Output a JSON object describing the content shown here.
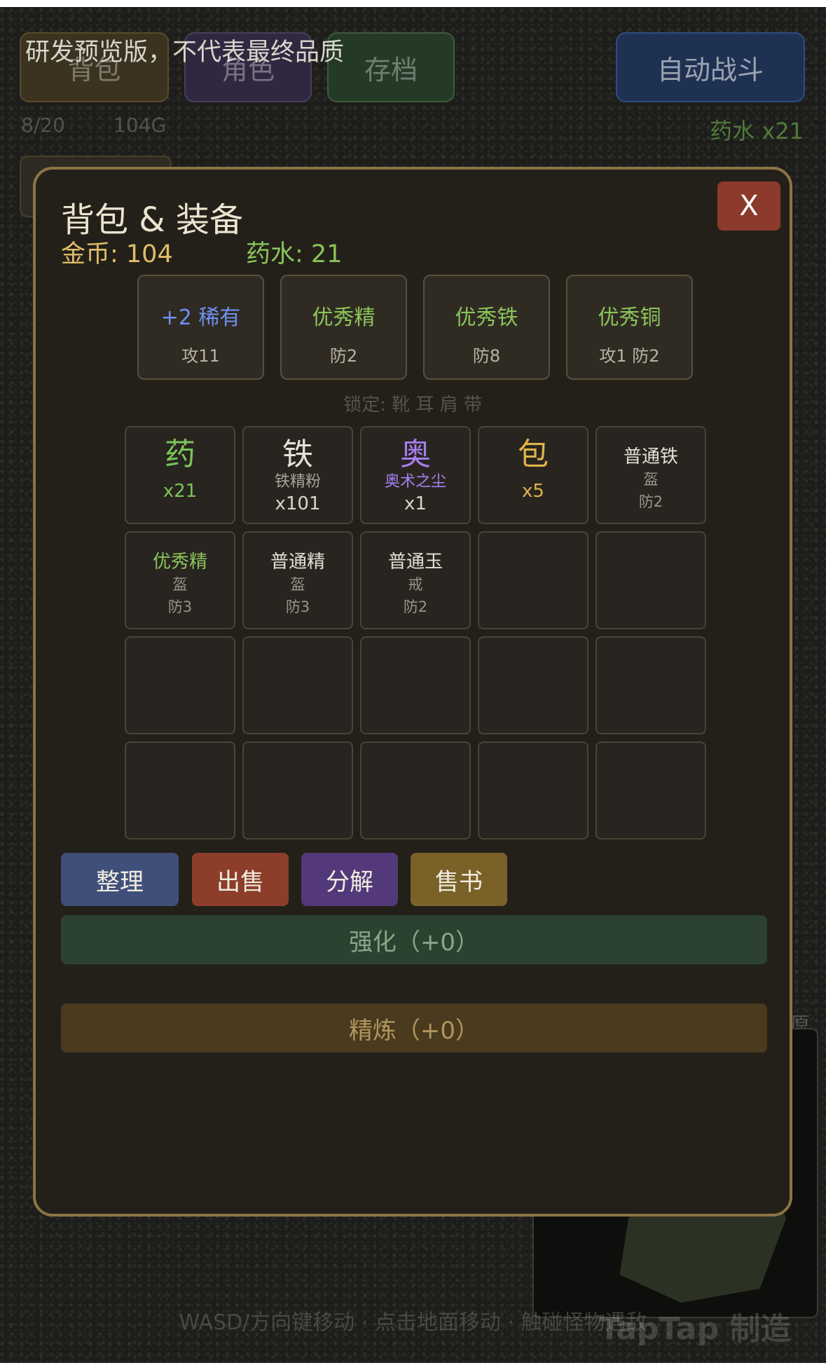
{
  "hud": {
    "notice": "研发预览版，不代表最终品质",
    "buttons": {
      "bag": "背包",
      "role": "角色",
      "save": "存档",
      "auto_battle": "自动战斗"
    },
    "bag_capacity": "8/20",
    "gold_short": "104G",
    "potion": "药水 x21",
    "hint": "WASD/方向键移动 · 点击地面移动 · 触碰怪物遇敌",
    "watermark": "TapTap 制造"
  },
  "modal": {
    "title": "背包 & 装备",
    "close_label": "X",
    "gold": "金币: 104",
    "potion": "药水: 21",
    "equipment": [
      {
        "name": "+2 稀有",
        "stat": "攻11",
        "color": "#6f8ff0"
      },
      {
        "name": "优秀精",
        "stat": "防2",
        "color": "#8bc45a"
      },
      {
        "name": "优秀铁",
        "stat": "防8",
        "color": "#8bc45a"
      },
      {
        "name": "优秀铜",
        "stat": "攻1 防2",
        "color": "#8bc45a"
      }
    ],
    "locked": "锁定: 靴 耳 肩 带",
    "inventory": [
      {
        "kind": "icon",
        "glyph": "药",
        "color": "#7cc45a",
        "sub": "",
        "count": "x21"
      },
      {
        "kind": "icon",
        "glyph": "铁",
        "color": "#e5e1d5",
        "sub": "铁精粉",
        "count": "x101"
      },
      {
        "kind": "icon",
        "glyph": "奥",
        "color": "#a77ef0",
        "sub": "奥术之尘",
        "count": "x1"
      },
      {
        "kind": "icon",
        "glyph": "包",
        "color": "#e0b24a",
        "sub": "",
        "count": "x5"
      },
      {
        "kind": "equip",
        "name": "普通铁",
        "slot": "盔",
        "stat": "防2",
        "color": "#e5e1d5"
      },
      {
        "kind": "equip",
        "name": "优秀精",
        "slot": "盔",
        "stat": "防3",
        "color": "#8bc45a"
      },
      {
        "kind": "equip",
        "name": "普通精",
        "slot": "盔",
        "stat": "防3",
        "color": "#e5e1d5"
      },
      {
        "kind": "equip",
        "name": "普通玉",
        "slot": "戒",
        "stat": "防2",
        "color": "#e5e1d5"
      },
      {
        "kind": "empty"
      },
      {
        "kind": "empty"
      },
      {
        "kind": "empty"
      },
      {
        "kind": "empty"
      },
      {
        "kind": "empty"
      },
      {
        "kind": "empty"
      },
      {
        "kind": "empty"
      },
      {
        "kind": "empty"
      },
      {
        "kind": "empty"
      },
      {
        "kind": "empty"
      },
      {
        "kind": "empty"
      },
      {
        "kind": "empty"
      }
    ],
    "actions": {
      "sort": "整理",
      "sell": "出售",
      "decompose": "分解",
      "sell_books": "售书"
    },
    "enhance": "强化（+0）",
    "refine": "精炼（+0）"
  }
}
